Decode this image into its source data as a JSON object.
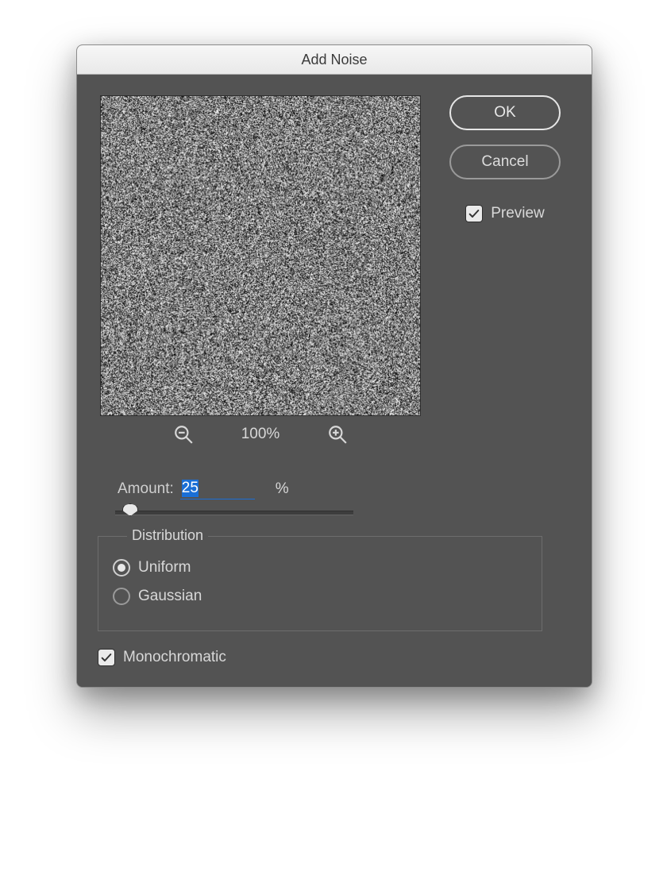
{
  "title": "Add Noise",
  "buttons": {
    "ok": "OK",
    "cancel": "Cancel"
  },
  "preview_checkbox": {
    "label": "Preview",
    "checked": true
  },
  "zoom": {
    "level": "100%"
  },
  "amount": {
    "label": "Amount:",
    "value": "25",
    "unit": "%",
    "slider_percent": 6
  },
  "distribution": {
    "legend": "Distribution",
    "options": [
      {
        "label": "Uniform",
        "selected": true
      },
      {
        "label": "Gaussian",
        "selected": false
      }
    ]
  },
  "monochromatic": {
    "label": "Monochromatic",
    "checked": true
  },
  "icons": {
    "zoom_out": "zoom-out-icon",
    "zoom_in": "zoom-in-icon",
    "check": "check-icon"
  }
}
